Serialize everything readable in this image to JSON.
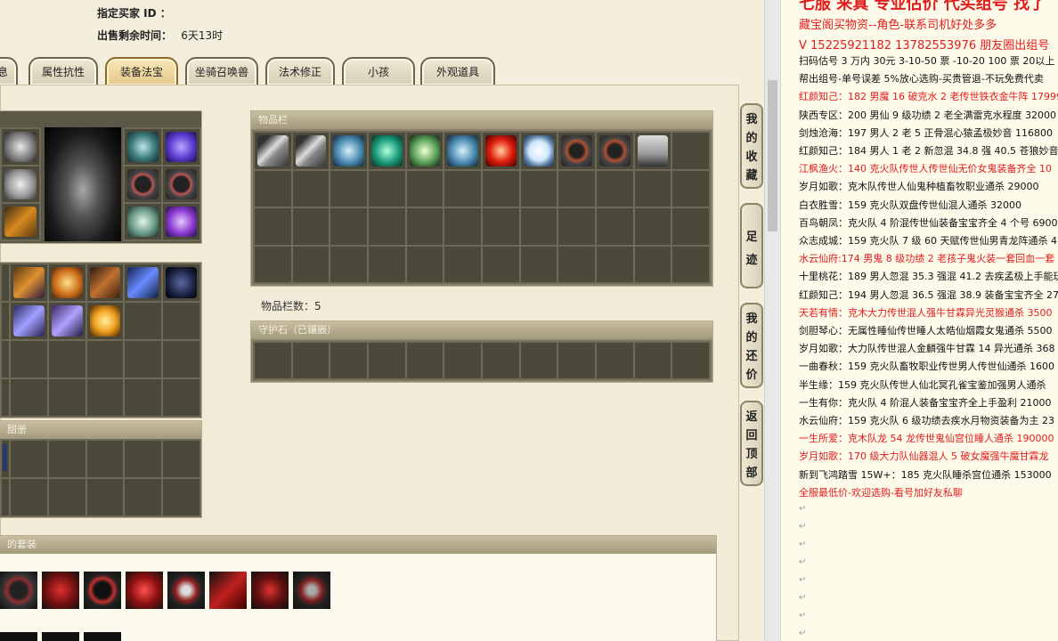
{
  "header": {
    "buyer_label": "指定买家 ID ：",
    "buyer_value": "",
    "remaining_label": "出售剩余时间：",
    "remaining_value": "6天13时"
  },
  "tabs": [
    {
      "label": "息"
    },
    {
      "label": "属性抗性"
    },
    {
      "label": "装备法宝"
    },
    {
      "label": "坐骑召唤兽"
    },
    {
      "label": "法术修正"
    },
    {
      "label": "小孩"
    },
    {
      "label": "外观道具"
    }
  ],
  "active_tab": "装备法宝",
  "panels": {
    "item_bar_title": "物品栏",
    "item_count_text": "物品栏数：5",
    "guard_stone_title": "守护石（已镶嵌）",
    "left_mid_title": "甜册",
    "set_title": "的套装"
  },
  "side_nav": [
    {
      "label": "我的收藏"
    },
    {
      "label": "足迹"
    },
    {
      "label": "我的还价"
    },
    {
      "label": "返回顶部"
    }
  ],
  "document": {
    "title_partial": "七服 来真 专业估价 代买组号 找了",
    "lines": [
      {
        "text": "藏宝阁买物资--角色-联系司机好处多多",
        "color": "red"
      },
      {
        "text": "V 15225921182    13782553976 朋友圈出组号",
        "color": "red"
      },
      {
        "text": "扫码估号 3 万内 30元 3-10-50 票 -10-20 100 票 20以上 3",
        "color": "black"
      },
      {
        "text": "帮出组号-单号误差 5%放心选购-买贵管退-不玩免费代卖",
        "color": "black"
      },
      {
        "text": "红颜知己：182 男魔 16 破克水 2 老传世铁衣金牛阵 179994",
        "color": "red"
      },
      {
        "text": "陕西专区：200 男仙 9 级功绩 2 老全满雷克水程度 32000",
        "color": "black"
      },
      {
        "text": "剑烛沧海：197 男人 2 老 5 正骨混心猿孟极妙音 116800",
        "color": "black"
      },
      {
        "text": "红颜知己：184 男人 1 老 2 新忽混 34.8 强 40.5 苍狼妙音 2",
        "color": "black"
      },
      {
        "text": "江枫渔火：140 克火队传世人传世仙无价女鬼装备齐全 10",
        "color": "red"
      },
      {
        "text": "岁月如歌：克木队传世人仙鬼种植畜牧职业通杀 29000",
        "color": "black"
      },
      {
        "text": "白衣胜雪：159 克火队双盘传世仙混人通杀 32000",
        "color": "black"
      },
      {
        "text": "百鸟朝凤：克火队 4 阶混传世仙装备宝宝齐全 4 个号 6900",
        "color": "black"
      },
      {
        "text": "众志成城：159 克火队 7 级 60 天赋传世仙男青龙阵通杀 4",
        "color": "black"
      },
      {
        "text": "水云仙府:174 男鬼 8 级功绩 2 老孩子鬼火装一套回血一套",
        "color": "red"
      },
      {
        "text": "十里桃花：189 男人忽混 35.3 强混 41.2 去疾孟极上手能玩",
        "color": "black"
      },
      {
        "text": "红颜知己：194 男人忽混 36.5 强混 38.9 装备宝宝齐全 275",
        "color": "black"
      },
      {
        "text": "天若有情：克木大力传世混人强牛甘霖异光灵猴通杀 3500",
        "color": "red"
      },
      {
        "text": "剑胆琴心：无属性睡仙传世睡人太皓仙烟霞女鬼通杀 5500",
        "color": "black"
      },
      {
        "text": "岁月如歌：大力队传世混人金麟强牛甘霖 14 异光通杀 368",
        "color": "black"
      },
      {
        "text": "一曲春秋：159 克火队畜牧职业传世男人传世仙通杀 1600",
        "color": "black"
      },
      {
        "text": "半生缘：159 克火队传世人仙北冥孔雀宝鉴加强男人通杀",
        "color": "black"
      },
      {
        "text": "一生有你：克火队 4 阶混人装备宝宝齐全上手盈利 21000",
        "color": "black"
      },
      {
        "text": "水云仙府：159 克火队 6 级功绩去疾水月物资装备为主 23",
        "color": "black"
      },
      {
        "text": "一生所爱：克木队龙 54 龙传世鬼仙宫位睡人通杀 190000",
        "color": "red"
      },
      {
        "text": "岁月如歌：170 级大力队仙器混人 5 破女魔强牛魔甘霖龙",
        "color": "red"
      },
      {
        "text": "新到飞鸿踏雪 15W+：185 克火队睡杀宫位通杀 153000",
        "color": "black"
      },
      {
        "text": "全服最低价-欢迎选购-看号加好友私聊",
        "color": "red"
      }
    ],
    "paragraph_mark": "↵"
  }
}
